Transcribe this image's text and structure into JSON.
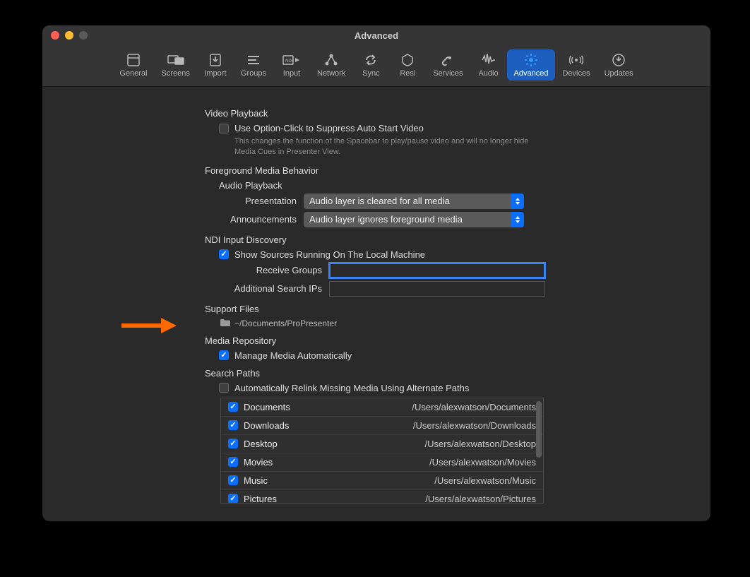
{
  "window": {
    "title": "Advanced"
  },
  "toolbar": {
    "items": [
      {
        "label": "General"
      },
      {
        "label": "Screens"
      },
      {
        "label": "Import"
      },
      {
        "label": "Groups"
      },
      {
        "label": "Input"
      },
      {
        "label": "Network"
      },
      {
        "label": "Sync"
      },
      {
        "label": "Resi"
      },
      {
        "label": "Services"
      },
      {
        "label": "Audio"
      },
      {
        "label": "Advanced"
      },
      {
        "label": "Devices"
      },
      {
        "label": "Updates"
      }
    ],
    "active_index": 10
  },
  "sections": {
    "video_playback": {
      "title": "Video Playback",
      "option": "Use Option-Click to Suppress Auto Start Video",
      "help": "This changes the function of the Spacebar to play/pause video and will no longer hide Media Cues in Presenter View."
    },
    "foreground": {
      "title": "Foreground Media Behavior",
      "audio_playback": "Audio Playback",
      "presentation_label": "Presentation",
      "presentation_value": "Audio layer is cleared for all media",
      "announcements_label": "Announcements",
      "announcements_value": "Audio layer ignores foreground media"
    },
    "ndi": {
      "title": "NDI Input Discovery",
      "show_sources": "Show Sources Running On The Local Machine",
      "receive_groups_label": "Receive Groups",
      "receive_groups_value": "",
      "additional_ips_label": "Additional Search IPs",
      "additional_ips_value": ""
    },
    "support_files": {
      "title": "Support Files",
      "path": "~/Documents/ProPresenter"
    },
    "media_repo": {
      "title": "Media Repository",
      "manage_auto": "Manage Media Automatically"
    },
    "search_paths": {
      "title": "Search Paths",
      "relink": "Automatically Relink Missing Media Using Alternate Paths",
      "rows": [
        {
          "checked": true,
          "name": "Documents",
          "path": "/Users/alexwatson/Documents"
        },
        {
          "checked": true,
          "name": "Downloads",
          "path": "/Users/alexwatson/Downloads"
        },
        {
          "checked": true,
          "name": "Desktop",
          "path": "/Users/alexwatson/Desktop"
        },
        {
          "checked": true,
          "name": "Movies",
          "path": "/Users/alexwatson/Movies"
        },
        {
          "checked": true,
          "name": "Music",
          "path": "/Users/alexwatson/Music"
        },
        {
          "checked": true,
          "name": "Pictures",
          "path": "/Users/alexwatson/Pictures"
        }
      ]
    }
  }
}
